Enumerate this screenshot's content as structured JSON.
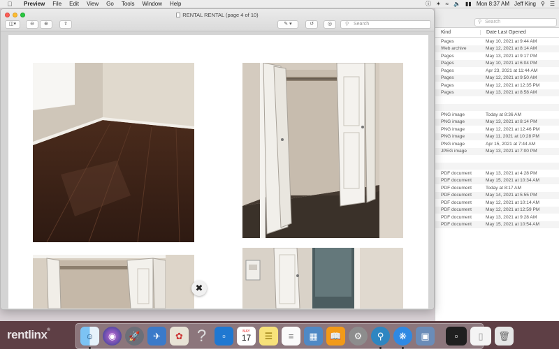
{
  "menubar": {
    "items": [
      "Preview",
      "File",
      "Edit",
      "View",
      "Go",
      "Tools",
      "Window",
      "Help"
    ],
    "clock": "Mon 8:37 AM",
    "user": "Jeff King"
  },
  "window": {
    "title": "RENTAL RENTAL (page 4 of 10)",
    "search_placeholder": "Search"
  },
  "background_list": {
    "search_placeholder": "Search",
    "columns": [
      "Kind",
      "Date Last Opened"
    ],
    "rows": [
      [
        "Pages",
        "May 10, 2021 at 9:44 AM"
      ],
      [
        "Web archive",
        "May 12, 2021 at 8:14 AM"
      ],
      [
        "Pages",
        "May 13, 2021 at 9:17 PM"
      ],
      [
        "Pages",
        "May 10, 2021 at 6:04 PM"
      ],
      [
        "Pages",
        "Apr 23, 2021 at 11:44 AM"
      ],
      [
        "Pages",
        "May 12, 2021 at 9:50 AM"
      ],
      [
        "Pages",
        "May 12, 2021 at 12:35 PM"
      ],
      [
        "Pages",
        "May 13, 2021 at 8:58 AM"
      ],
      [
        "",
        ""
      ],
      [
        "",
        ""
      ],
      [
        "PNG image",
        "Today at 8:36 AM"
      ],
      [
        "PNG image",
        "May 13, 2021 at 8:14 PM"
      ],
      [
        "PNG image",
        "May 12, 2021 at 12:46 PM"
      ],
      [
        "PNG image",
        "May 11, 2021 at 10:28 PM"
      ],
      [
        "PNG image",
        "Apr 15, 2021 at 7:44 AM"
      ],
      [
        "JPEG image",
        "May 13, 2021 at 7:00 PM"
      ],
      [
        "",
        ""
      ],
      [
        "",
        ""
      ],
      [
        "PDF document",
        "May 13, 2021 at 4:28 PM"
      ],
      [
        "PDF document",
        "May 15, 2021 at 10:34 AM"
      ],
      [
        "PDF document",
        "Today at 8:17 AM"
      ],
      [
        "PDF document",
        "May 14, 2021 at 5:55 PM"
      ],
      [
        "PDF document",
        "May 12, 2021 at 10:14 AM"
      ],
      [
        "PDF document",
        "May 12, 2021 at 12:59 PM"
      ],
      [
        "PDF document",
        "May 13, 2021 at 9:28 AM"
      ],
      [
        "PDF document",
        "May 15, 2021 at 10:54 AM"
      ]
    ]
  },
  "watermark": "rentlinx",
  "dock": {
    "calendar_month": "MAY",
    "calendar_day": "17",
    "help_glyph": "?"
  }
}
